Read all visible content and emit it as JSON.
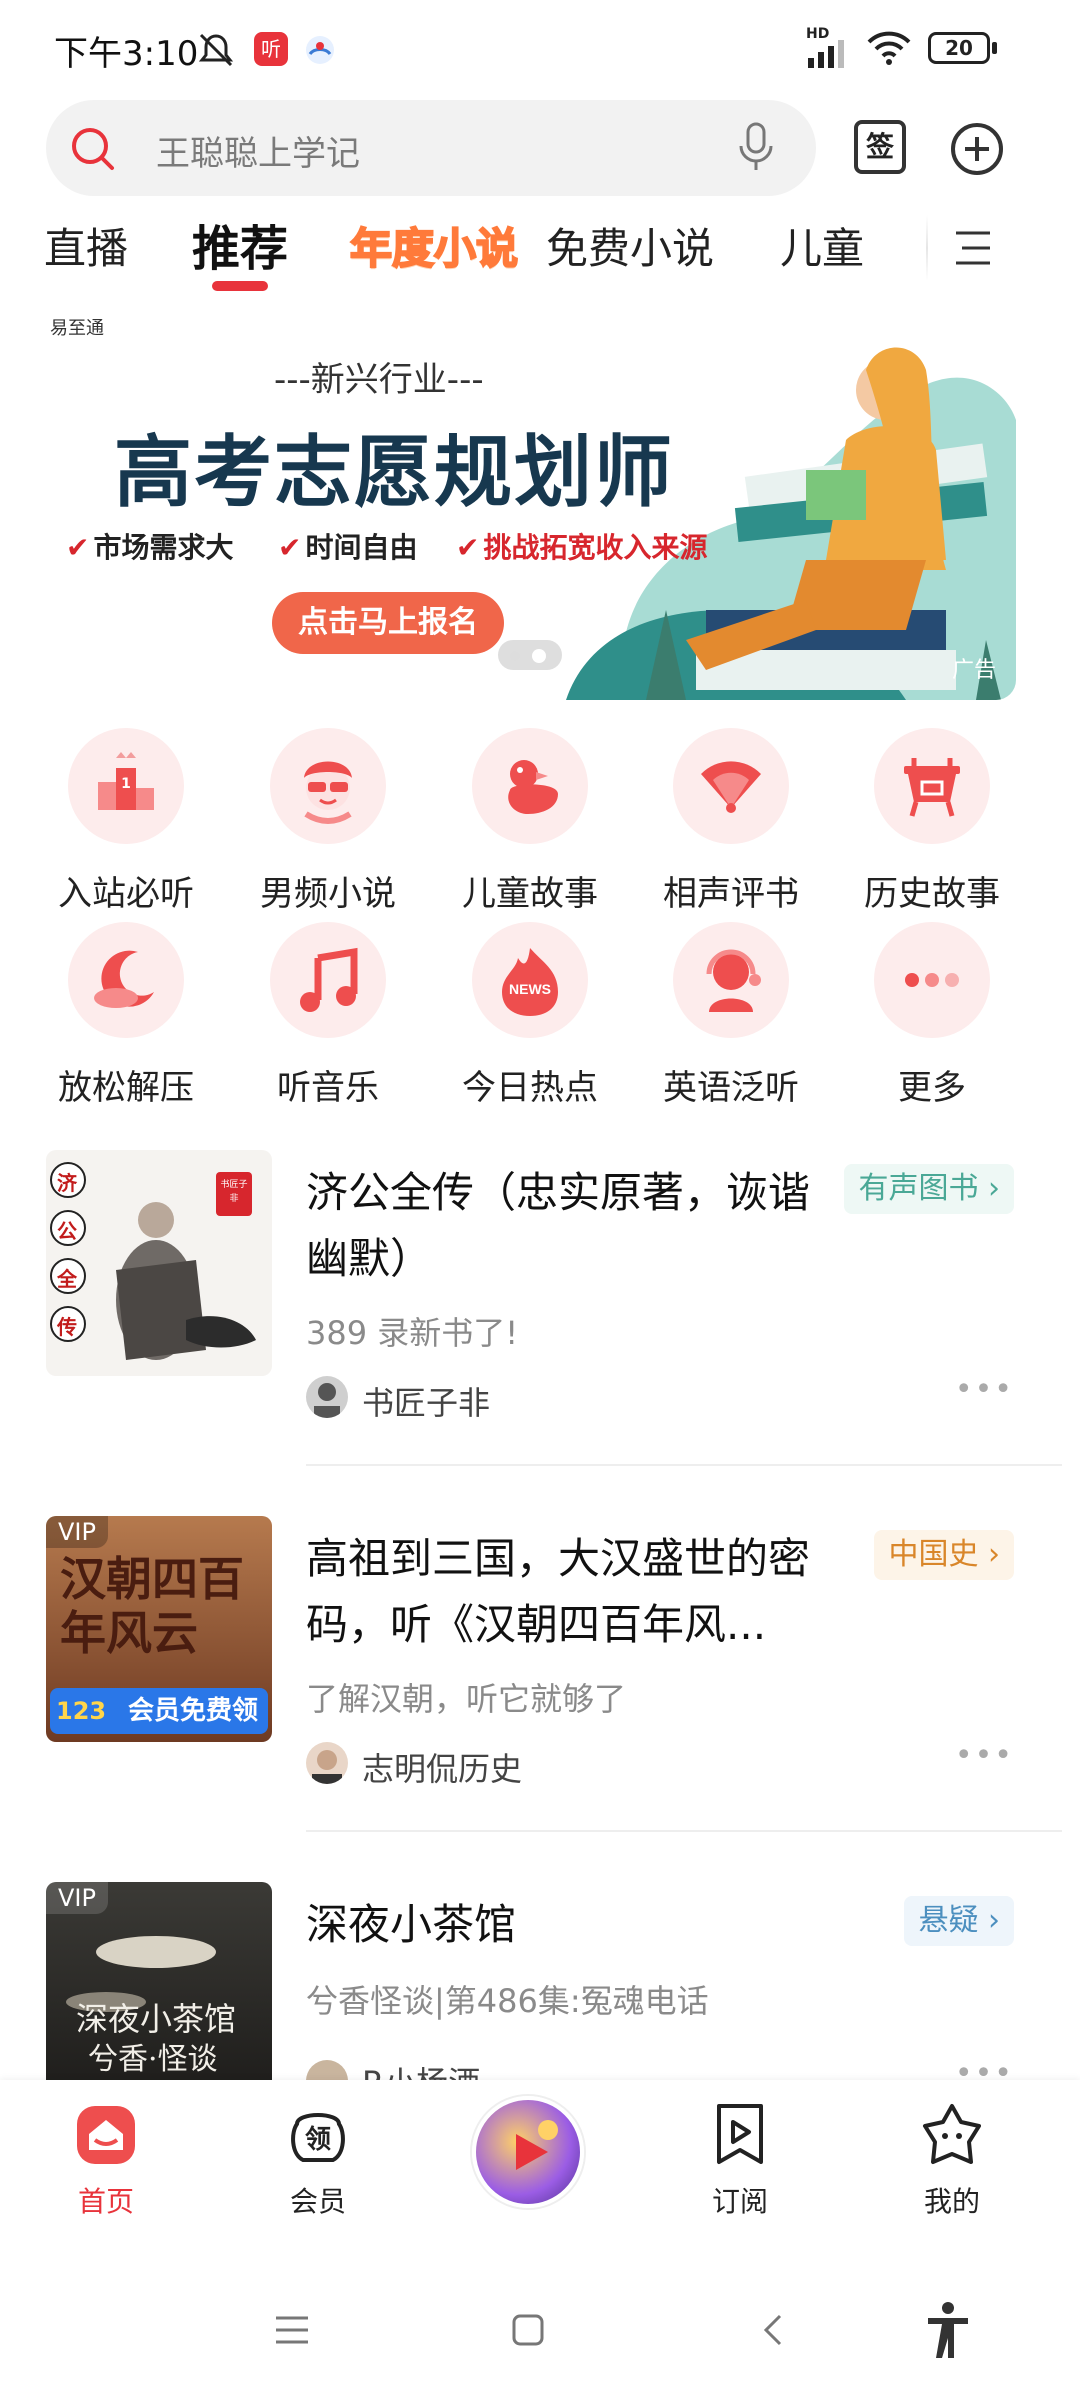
{
  "status_bar": {
    "time": "下午3:10",
    "hd_label": "HD",
    "battery": "20",
    "app_badge_1": "听"
  },
  "search": {
    "placeholder": "王聪聪上学记",
    "sign_label": "签"
  },
  "tabs": {
    "items": [
      "直播",
      "推荐",
      "年度小说",
      "免费小说",
      "儿童"
    ],
    "active_index": 1
  },
  "banner": {
    "brand": "易至通",
    "subtitle": "---新兴行业---",
    "title": "高考志愿规划师",
    "features": [
      "市场需求大",
      "时间自由",
      "挑战拓宽收入来源"
    ],
    "cta": "点击马上报名",
    "ad_label": "广告"
  },
  "categories": [
    {
      "label": "入站必听",
      "icon": "podium-icon"
    },
    {
      "label": "男频小说",
      "icon": "man-glasses-icon"
    },
    {
      "label": "儿童故事",
      "icon": "duck-icon"
    },
    {
      "label": "相声评书",
      "icon": "fan-icon"
    },
    {
      "label": "历史故事",
      "icon": "ancient-vessel-icon"
    },
    {
      "label": "放松解压",
      "icon": "moon-cloud-icon"
    },
    {
      "label": "听音乐",
      "icon": "music-note-icon"
    },
    {
      "label": "今日热点",
      "icon": "news-flame-icon"
    },
    {
      "label": "英语泛听",
      "icon": "headset-person-icon"
    },
    {
      "label": "更多",
      "icon": "more-dots-icon"
    }
  ],
  "feed": [
    {
      "title": "济公全传（忠实原著，诙谐幽默）",
      "tag": "有声图书",
      "subtitle": "389 录新书了!",
      "author": "书匠子非",
      "cover_text": [
        "济",
        "公",
        "全",
        "传"
      ],
      "cover_seal": "书匠子非"
    },
    {
      "title": "高祖到三国，大汉盛世的密码，听《汉朝四百年风...",
      "tag": "中国史",
      "subtitle": "了解汉朝，听它就够了",
      "author": "志明侃历史",
      "cover_vip": "VIP",
      "cover_title": "汉朝四百年风云",
      "cover_badge": "会员免费领",
      "cover_num": "123"
    },
    {
      "title": "深夜小茶馆",
      "tag": "悬疑",
      "subtitle": "兮香怪谈|第486集:冤魂电话",
      "author": "R小杨酒",
      "cover_vip": "VIP",
      "cover_title": "深夜小茶馆",
      "cover_title2": "兮香·怪谈"
    }
  ],
  "bottom_nav": [
    {
      "label": "首页",
      "icon": "home-icon"
    },
    {
      "label": "会员",
      "icon": "vip-bag-icon"
    },
    {
      "label": "",
      "icon": "featured-promo-icon"
    },
    {
      "label": "订阅",
      "icon": "bookmark-play-icon"
    },
    {
      "label": "我的",
      "icon": "star-face-icon"
    }
  ],
  "colors": {
    "accent": "#e8333b",
    "tag_green_text": "#4aa896",
    "tag_green_bg": "#eef8f5",
    "tag_orange_text": "#d9862a",
    "tag_orange_bg": "#fdf4e8",
    "tag_blue_text": "#4c8fbf",
    "tag_blue_bg": "#eef5fb"
  }
}
